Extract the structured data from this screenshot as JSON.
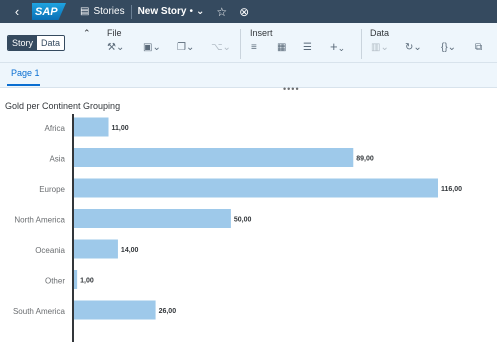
{
  "shell": {
    "back_icon": "chevron-left-icon",
    "logo_text": "SAP",
    "stories_label": "Stories",
    "story_name": "New Story",
    "modified_mark": "•",
    "dropdown_icon": "chevron-down-icon",
    "favorite_icon": "star-icon",
    "close_icon": "close-circle-icon"
  },
  "toolbar": {
    "view_toggle": {
      "story": "Story",
      "data": "Data",
      "selected": "Story"
    },
    "groups": {
      "file": "File",
      "insert": "Insert",
      "data": "Data"
    },
    "file_icons": [
      "tools-icon",
      "save-icon",
      "copy-icon",
      "share-icon"
    ],
    "insert_icons": [
      "chart-icon",
      "table-icon",
      "filter-icon",
      "add-icon"
    ],
    "data_icons": [
      "refresh-disabled-icon",
      "refresh-icon",
      "formula-icon",
      "copy-data-icon"
    ]
  },
  "pages": {
    "tabs": [
      "Page 1"
    ],
    "active": "Page 1"
  },
  "chart_data": {
    "type": "bar",
    "orientation": "horizontal",
    "title": "Gold per Continent Grouping",
    "categories": [
      "Africa",
      "Asia",
      "Europe",
      "North America",
      "Oceania",
      "Other",
      "South America"
    ],
    "values": [
      11,
      89,
      116,
      50,
      14,
      1,
      26
    ],
    "value_labels": [
      "11,00",
      "89,00",
      "116,00",
      "50,00",
      "14,00",
      "1,00",
      "26,00"
    ],
    "xlim": [
      0,
      116
    ],
    "bar_color": "#9ec9ea",
    "grid": false
  }
}
